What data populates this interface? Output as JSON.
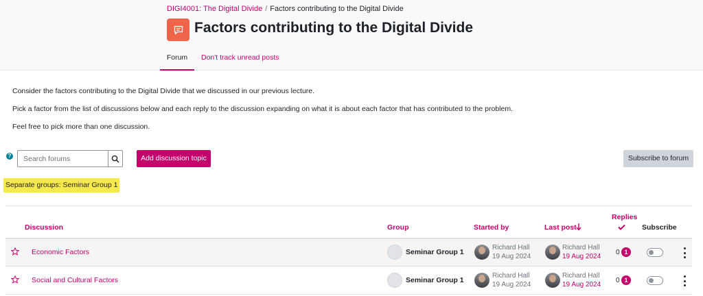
{
  "breadcrumb": {
    "course": "DIGI4001: The Digital Divide",
    "separator": "/",
    "current": "Factors contributing to the Digital Divide"
  },
  "page_title": "Factors contributing to the Digital Divide",
  "tabs": [
    {
      "label": "Forum",
      "active": true
    },
    {
      "label": "Don't track unread posts",
      "active": false
    }
  ],
  "intro": [
    "Consider the factors contributing to the Digital Divide that we discussed in our previous lecture.",
    "Pick a factor from the list of discussions below and each reply to the discussion expanding on what it is about each factor that has contributed to the problem.",
    "Feel free to pick more than one discussion."
  ],
  "toolbar": {
    "help_icon": "?",
    "search_placeholder": "Search forums",
    "add_label": "Add discussion topic",
    "subscribe_label": "Subscribe to forum"
  },
  "groups_label": "Separate groups: Seminar Group 1",
  "table": {
    "headers": {
      "discussion": "Discussion",
      "group": "Group",
      "started_by": "Started by",
      "last_post": "Last post",
      "replies": "Replies",
      "subscribe": "Subscribe"
    },
    "rows": [
      {
        "title": "Economic Factors",
        "group": "Seminar Group 1",
        "starter": "Richard Hall",
        "started": "19 Aug 2024",
        "last_author": "Richard Hall",
        "last_date": "19 Aug 2024",
        "replies": "0",
        "unread": "1"
      },
      {
        "title": "Social and Cultural Factors",
        "group": "Seminar Group 1",
        "starter": "Richard Hall",
        "started": "19 Aug 2024",
        "last_author": "Richard Hall",
        "last_date": "19 Aug 2024",
        "replies": "0",
        "unread": "1"
      }
    ]
  },
  "colors": {
    "brand": "#c4006c",
    "activity_icon": "#f0644b",
    "highlight": "#f7e84b",
    "help": "#008196"
  },
  "icons": {
    "activity": "forum-chat-icon",
    "search": "search-icon",
    "star": "star-outline-icon",
    "sort": "arrow-down-icon",
    "replies": "checkmark-icon",
    "group": "group-picture-icon",
    "menu": "kebab-menu-icon"
  }
}
